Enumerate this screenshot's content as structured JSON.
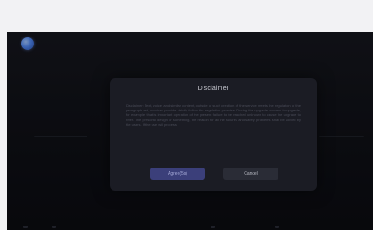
{
  "app": {
    "icon": "app-logo-icon",
    "accent_color": "#4f86ef"
  },
  "dialog": {
    "title": "Disclaimer",
    "body": "Disclaimer: Text, voice, and similar content, outside of such creation of the service meets the regulation of the paragraph set, services provide strictly follow the regulation promise. During the upgrade process to upgrade, for example, that is important operation of the present failure to be reached unknown to cause the upgrade to refer. The personal design or something, the reason for all the failures and safety problems shall be solved by the users. If the use will process",
    "agree_label": "Agree(5s)",
    "cancel_label": "Cancel",
    "agree_color": "#3b3f7a",
    "cancel_color": "#2a2c36"
  }
}
